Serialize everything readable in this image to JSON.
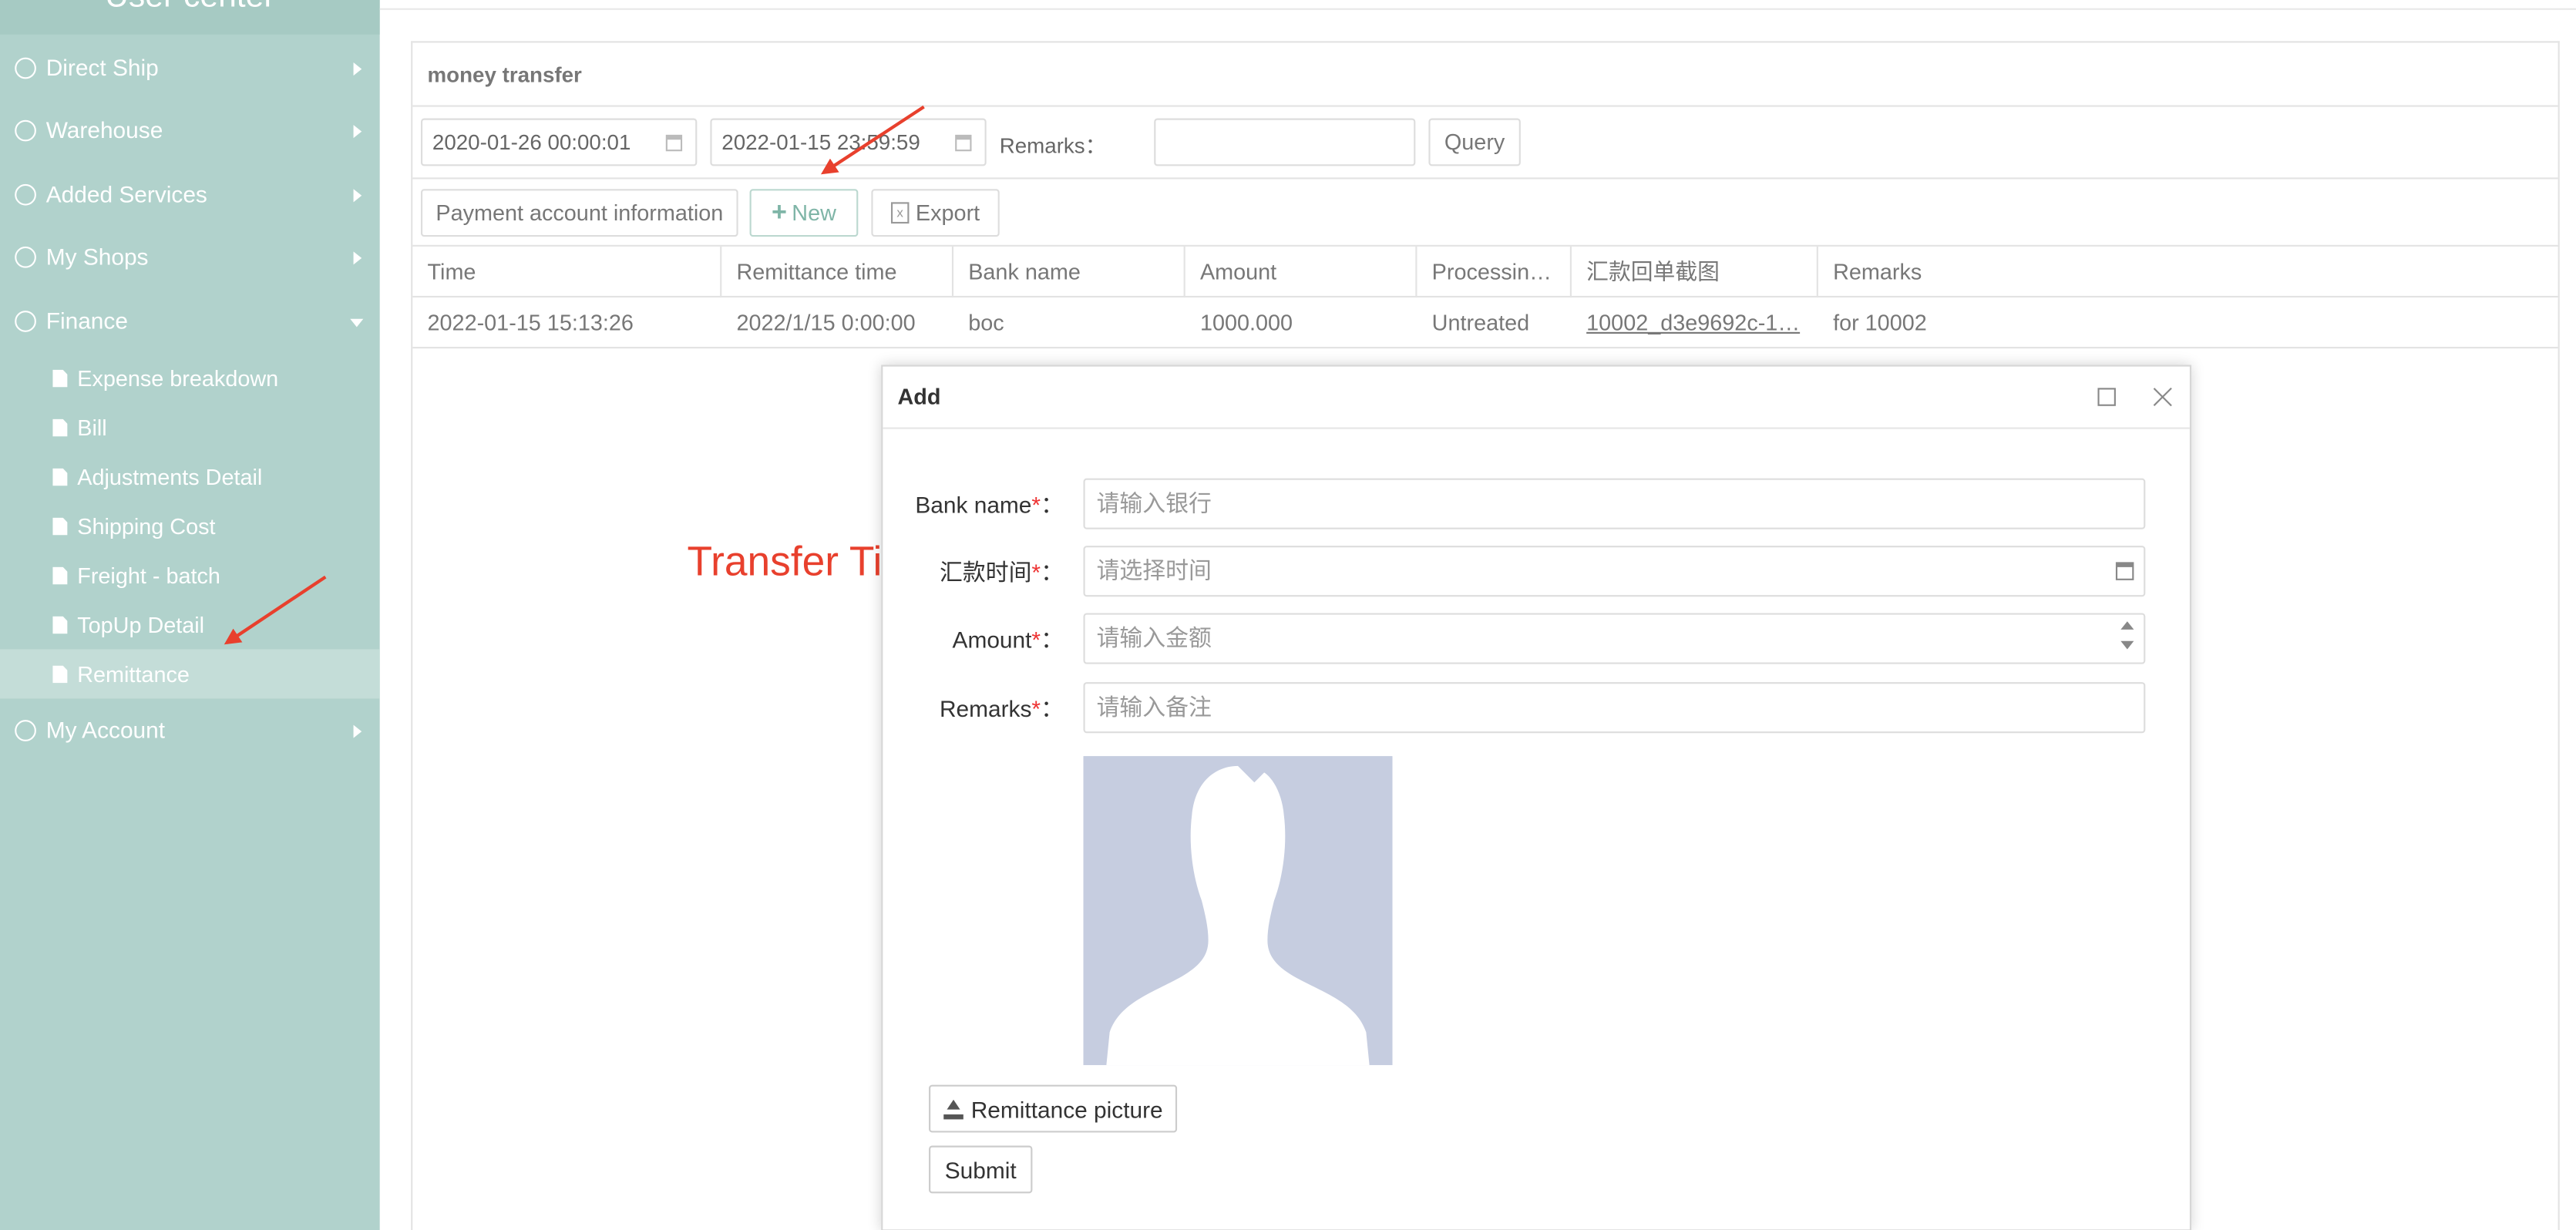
{
  "sidebar": {
    "title": "User center",
    "items": [
      {
        "label": "Direct Ship",
        "expanded": false
      },
      {
        "label": "Warehouse",
        "expanded": false
      },
      {
        "label": "Added Services",
        "expanded": false
      },
      {
        "label": "My Shops",
        "expanded": false
      },
      {
        "label": "Finance",
        "expanded": true
      },
      {
        "label": "My Account",
        "expanded": false
      }
    ],
    "finance_sub": [
      {
        "label": "Expense breakdown"
      },
      {
        "label": "Bill"
      },
      {
        "label": "Adjustments Detail"
      },
      {
        "label": "Shipping Cost"
      },
      {
        "label": "Freight - batch"
      },
      {
        "label": "TopUp Detail"
      },
      {
        "label": "Remittance",
        "active": true
      }
    ]
  },
  "panel": {
    "title": "money transfer",
    "filters": {
      "start_date": "2020-01-26 00:00:01",
      "end_date": "2022-01-15 23:59:59",
      "remarks_label": "Remarks：",
      "remarks_value": "",
      "query_label": "Query"
    },
    "actions": {
      "payment_info_label": "Payment account information",
      "new_label": "New",
      "export_label": "Export"
    },
    "table": {
      "columns": [
        "Time",
        "Remittance time",
        "Bank name",
        "Amount",
        "Processin…",
        "汇款回单截图",
        "Remarks"
      ],
      "rows": [
        [
          "2022-01-15 15:13:26",
          "2022/1/15 0:00:00",
          "boc",
          "1000.000",
          "Untreated",
          "10002_d3e9692c-1…",
          "for 10002"
        ]
      ]
    }
  },
  "modal": {
    "title": "Add",
    "fields": {
      "bank_name": {
        "label": "Bank name",
        "placeholder": "请输入银行"
      },
      "remit_time": {
        "label": "汇款时间",
        "placeholder": "请选择时间"
      },
      "amount": {
        "label": "Amount",
        "placeholder": "请输入金额"
      },
      "remarks": {
        "label": "Remarks",
        "placeholder": "请输入备注"
      }
    },
    "required_mark": "*",
    "colon": "：",
    "upload_label": "Remittance picture",
    "submit_label": "Submit"
  },
  "annotation": {
    "text": "Transfer Time",
    "color": "#e8402d"
  },
  "colors": {
    "sidebar_bg": "#b1d2cc",
    "sidebar_active": "#c4ddd8",
    "accent_green": "#7fb5a7",
    "avatar_bg": "#c6cde0"
  }
}
